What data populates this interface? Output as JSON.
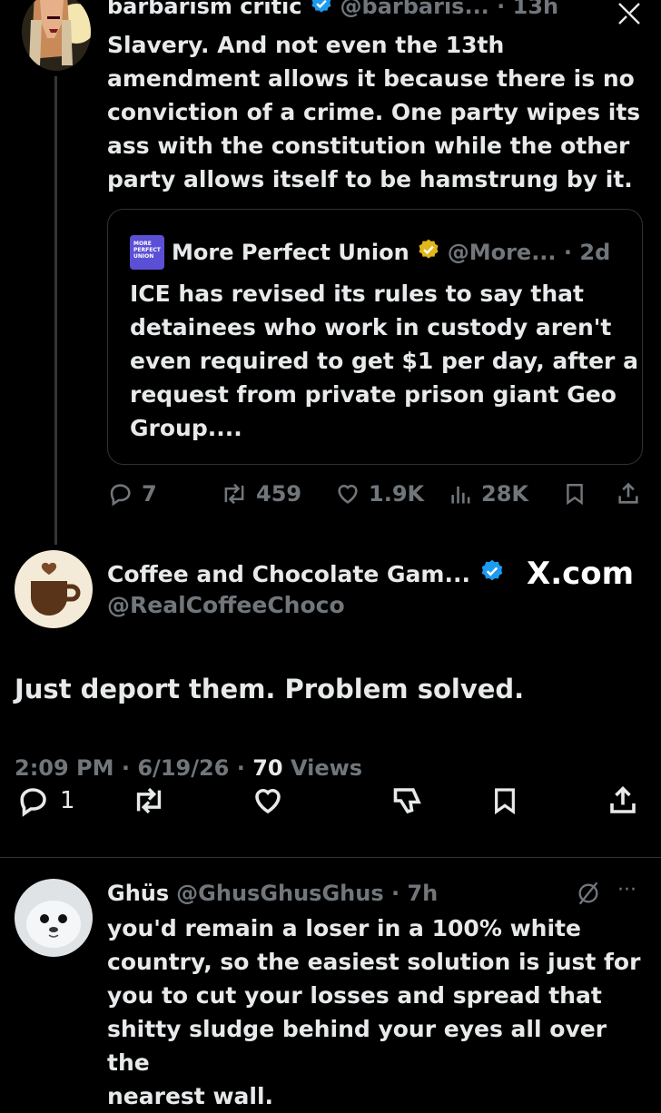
{
  "tweet1": {
    "display_name": "barbarism critic",
    "handle_time": "@barbaris... · 13h",
    "text_lines": [
      "Slavery. And not even the 13th",
      "amendment allows it because there is no",
      "conviction of a crime. One party wipes its",
      "ass with the constitution while the other",
      "party allows itself to be hamstrung by it."
    ],
    "quote": {
      "logo_text": "MORE PERFECT UNION",
      "display_name": "More Perfect Union",
      "handle_time": "@More... · 2d",
      "text_lines": [
        "ICE has revised its rules to say that",
        "detainees who work in custody aren't",
        "even required to get $1 per day, after a",
        "request from private prison giant Geo",
        "Group...."
      ]
    },
    "stats": {
      "replies": "7",
      "reposts": "459",
      "likes": "1.9K",
      "views": "28K"
    }
  },
  "tweet2": {
    "display_name": "Coffee and Chocolate Gam...",
    "handle": "@RealCoffeeChoco",
    "watermark": "X.com",
    "text": "Just deport them. Problem solved.",
    "meta_time": "2:09 PM · 6/19/26 · ",
    "meta_views_count": "70",
    "meta_views_label": " Views",
    "replies": "1"
  },
  "tweet3": {
    "display_name": "Ghüs",
    "handle_time": "@GhusGhusGhus · 7h",
    "more": "···",
    "text_lines": [
      "you'd remain a loser in a 100% white",
      "country, so the easiest solution is just for",
      "you to cut your losses and spread that",
      "shitty sludge behind your eyes all over the",
      "nearest wall."
    ]
  },
  "colors": {
    "background": "#000000",
    "text": "#e7e9ea",
    "muted": "#71767b",
    "verified_blue": "#1d9bf0",
    "verified_gold": "#e2b719",
    "divider": "#2f3336"
  }
}
